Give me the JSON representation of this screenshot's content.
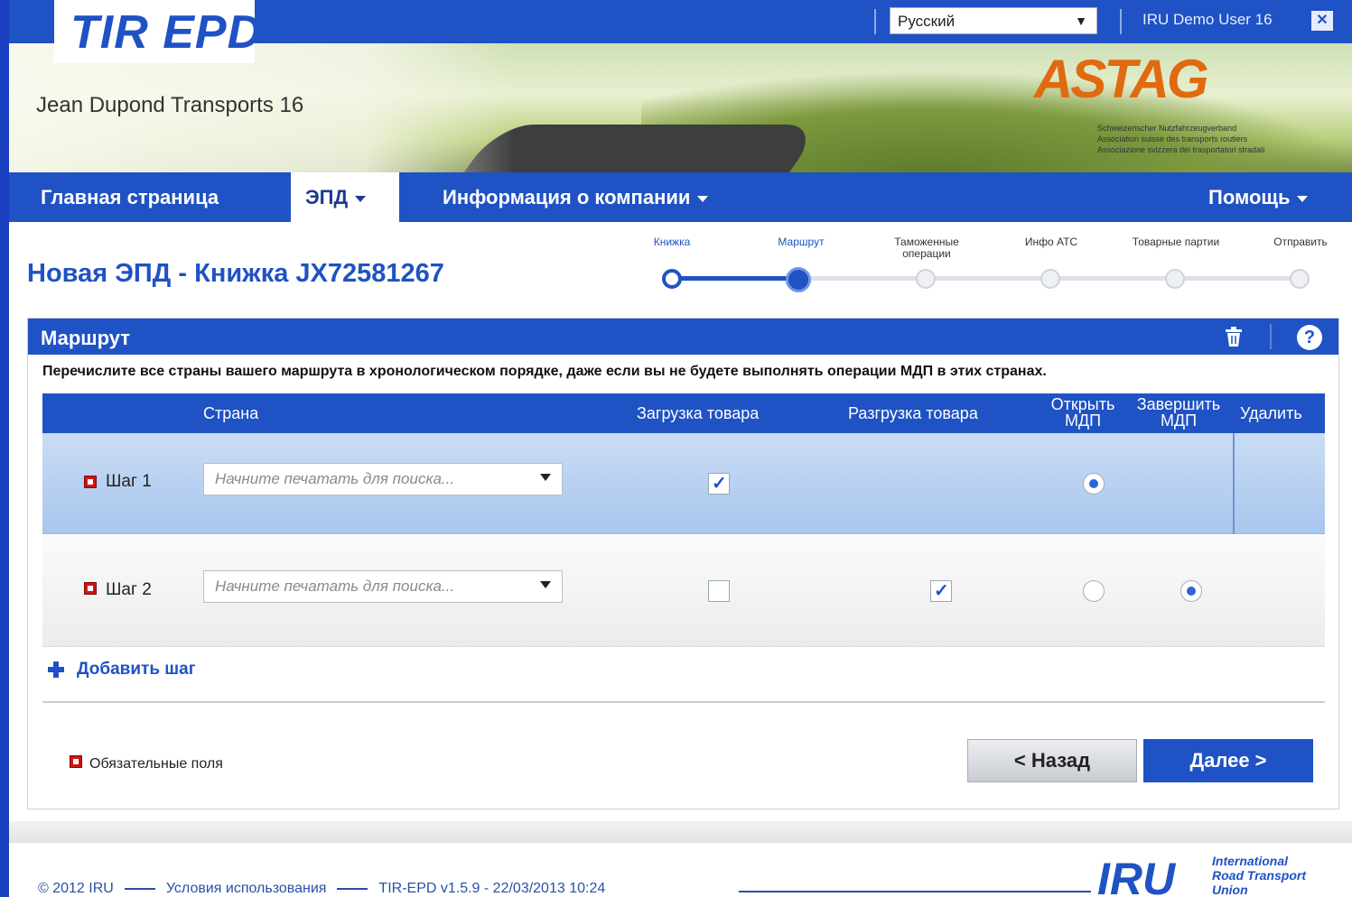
{
  "header": {
    "logo": "TIR EPD",
    "language": "Русский",
    "user": "IRU Demo User 16",
    "company": "Jean Dupond Transports 16",
    "partner_logo": "ASTAG",
    "partner_lines": [
      "Schweizerischer Nutzfahrzeugverband",
      "Association suisse des transports routiers",
      "Associazione svizzera dei trasportatori stradali"
    ]
  },
  "nav": {
    "home": "Главная страница",
    "epd": "ЭПД",
    "company_info": "Информация о компании",
    "help": "Помощь"
  },
  "page": {
    "title": "Новая ЭПД - Книжка JX72581267"
  },
  "stepper": {
    "steps": [
      "Книжка",
      "Маршрут",
      "Таможенные операции",
      "Инфо АТС",
      "Товарные партии",
      "Отправить"
    ],
    "current_index": 1
  },
  "route_panel": {
    "title": "Маршрут",
    "instruction": "Перечислите все страны вашего маршрута в хронологическом порядке, даже если вы не будете выполнять операции МДП в этих странах.",
    "columns": {
      "country": "Страна",
      "loading": "Загрузка товара",
      "unloading": "Разгрузка товара",
      "open_tir_1": "Открыть",
      "open_tir_2": "МДП",
      "close_tir_1": "Завершить",
      "close_tir_2": "МДП",
      "delete": "Удалить"
    },
    "rows": [
      {
        "label": "Шаг 1",
        "country_placeholder": "Начните печатать для поиска...",
        "loading": true,
        "unloading": false,
        "open_tir": true,
        "close_tir": false
      },
      {
        "label": "Шаг 2",
        "country_placeholder": "Начните печатать для поиска...",
        "loading": false,
        "unloading": true,
        "open_tir": false,
        "close_tir": true
      }
    ],
    "add_step": "Добавить шаг",
    "required_legend": "Обязательные поля",
    "back_button": "< Назад",
    "next_button": "Далее >"
  },
  "footer": {
    "copyright": "© 2012 IRU",
    "terms": "Условия использования",
    "version": "TIR-EPD v1.5.9 - 22/03/2013 10:24",
    "iru_logo": "IRU",
    "iru_line1": "International",
    "iru_line2": "Road Transport",
    "iru_line3": "Union"
  },
  "colors": {
    "brand_blue": "#1f52c4",
    "required_red": "#d01414",
    "partner_orange": "#e06a10"
  }
}
